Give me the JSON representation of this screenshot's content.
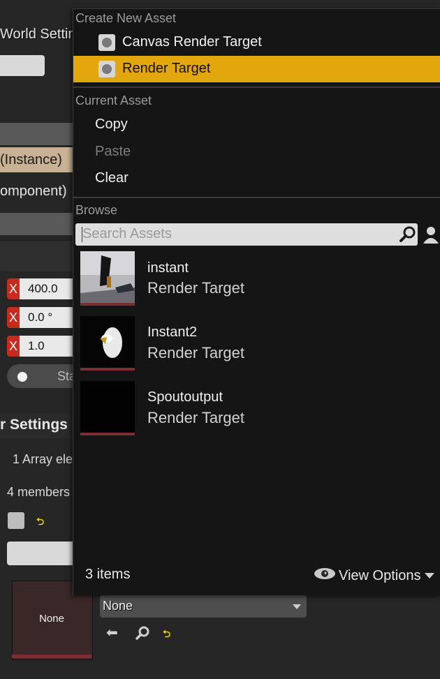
{
  "background": {
    "panel_title": "World Settin",
    "instance_label": "(Instance)",
    "component_label": "omponent)",
    "vector_rows": [
      {
        "axis": "X",
        "value": "400.0"
      },
      {
        "axis": "X",
        "value": "0.0 °"
      },
      {
        "axis": "X",
        "value": "1.0"
      }
    ],
    "static_label": "Sta",
    "section_title": "r Settings",
    "array_label": "1 Array ele",
    "members_label": "4 members",
    "texture_thumb_label": "None",
    "texture_combo_value": "None"
  },
  "menu": {
    "create_header": "Create New Asset",
    "create_items": [
      {
        "label": "Canvas Render Target",
        "icon": "render-target-icon",
        "selected": false
      },
      {
        "label": "Render Target",
        "icon": "render-target-icon",
        "selected": true
      }
    ],
    "current_header": "Current Asset",
    "current_items": [
      {
        "label": "Copy",
        "enabled": true
      },
      {
        "label": "Paste",
        "enabled": false
      },
      {
        "label": "Clear",
        "enabled": true
      }
    ],
    "browse_header": "Browse",
    "search_placeholder": "Search Assets",
    "assets": [
      {
        "name": "instant",
        "type": "Render Target"
      },
      {
        "name": "Instant2",
        "type": "Render Target"
      },
      {
        "name": "Spoutoutput",
        "type": "Render Target"
      }
    ],
    "items_count": "3 items",
    "view_options": "View Options"
  },
  "colors": {
    "selection": "#e3a70d",
    "axis_x": "#c62b1e",
    "menu_bg": "#151515",
    "thumb_bar": "#7a3030"
  }
}
